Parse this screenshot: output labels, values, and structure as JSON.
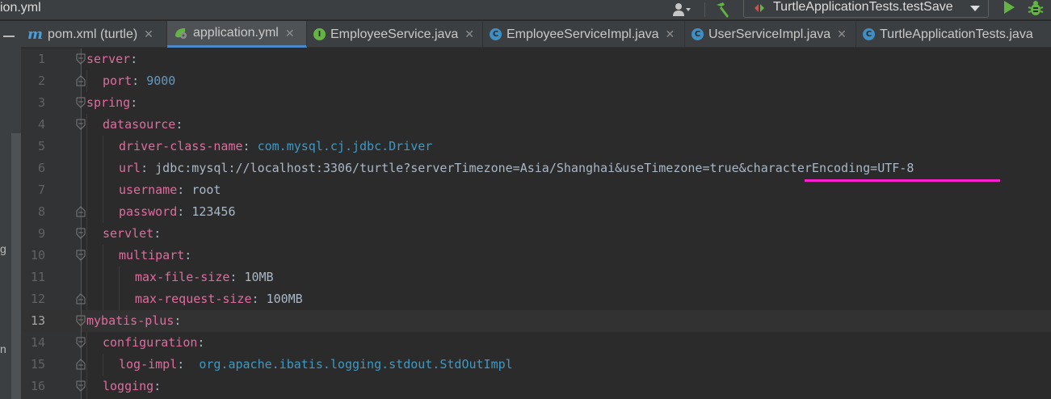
{
  "window": {
    "title_fragment": "ion.yml",
    "run_config": "TurtleApplicationTests.testSave"
  },
  "tabs": [
    {
      "label": "pom.xml (turtle)",
      "icon": "maven-icon",
      "active": false
    },
    {
      "label": "application.yml",
      "icon": "spring-yml-icon",
      "active": true
    },
    {
      "label": "EmployeeService.java",
      "icon": "interface-icon",
      "active": false
    },
    {
      "label": "EmployeeServiceImpl.java",
      "icon": "class-icon",
      "active": false
    },
    {
      "label": "UserServiceImpl.java",
      "icon": "class-icon",
      "active": false
    },
    {
      "label": "TurtleApplicationTests.java",
      "icon": "test-class-icon",
      "active": false
    }
  ],
  "editor": {
    "current_line": 13,
    "line_numbers": [
      "1",
      "2",
      "3",
      "4",
      "5",
      "6",
      "7",
      "8",
      "9",
      "10",
      "11",
      "12",
      "13",
      "14",
      "15",
      "16"
    ],
    "lines": [
      {
        "key": "server",
        "sep": ":",
        "value": ""
      },
      {
        "key": "port",
        "sep": ": ",
        "value": "9000"
      },
      {
        "key": "spring",
        "sep": ":",
        "value": ""
      },
      {
        "key": "datasource",
        "sep": ":",
        "value": ""
      },
      {
        "key": "driver-class-name",
        "sep": ": ",
        "value": "com.mysql.cj.jdbc.Driver"
      },
      {
        "key": "url",
        "sep": ": ",
        "value": "jdbc:mysql://localhost:3306/turtle?serverTimezone=Asia/Shanghai&useTimezone=true&characterEncoding=UTF-8"
      },
      {
        "key": "username",
        "sep": ": ",
        "value": "root"
      },
      {
        "key": "password",
        "sep": ": ",
        "value": "123456"
      },
      {
        "key": "servlet",
        "sep": ":",
        "value": ""
      },
      {
        "key": "multipart",
        "sep": ":",
        "value": ""
      },
      {
        "key": "max-file-size",
        "sep": ": ",
        "value": "10MB"
      },
      {
        "key": "max-request-size",
        "sep": ": ",
        "value": "100MB"
      },
      {
        "key": "mybatis-plus",
        "sep": ":",
        "value": ""
      },
      {
        "key": "configuration",
        "sep": ":",
        "value": ""
      },
      {
        "key": "log-impl",
        "sep": ":  ",
        "value": "org.apache.ibatis.logging.stdout.StdOutImpl"
      },
      {
        "key": "logging",
        "sep": ":",
        "value": ""
      }
    ]
  },
  "left_strip": {
    "fragments": [
      "g",
      "n"
    ]
  },
  "colors": {
    "key": "#e06c9f",
    "number": "#6897bb",
    "package": "#3d9ac4",
    "highlight_underline": "#ff1ed2",
    "active_tab_accent": "#4a88c7"
  }
}
